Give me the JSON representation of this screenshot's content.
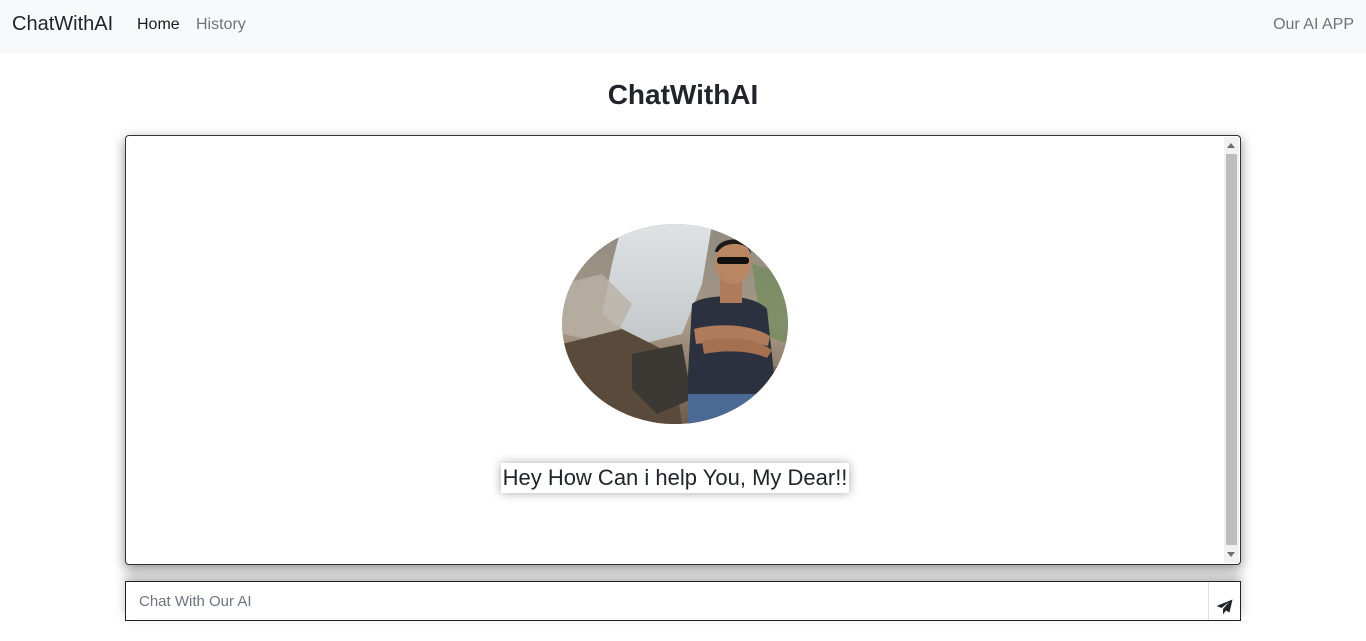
{
  "navbar": {
    "brand": "ChatWithAI",
    "links": [
      {
        "label": "Home",
        "active": true
      },
      {
        "label": "History",
        "active": false
      }
    ],
    "right_label": "Our AI APP"
  },
  "main": {
    "title": "ChatWithAI"
  },
  "chat": {
    "greeting": "Hey How Can i help You, My Dear!!",
    "avatar_icon": "profile-photo"
  },
  "input": {
    "placeholder": "Chat With Our AI",
    "value": "",
    "send_icon": "paper-plane-icon"
  },
  "colors": {
    "navbar_bg": "#f8f9fa",
    "text": "#212529",
    "muted": "#6c757d"
  }
}
